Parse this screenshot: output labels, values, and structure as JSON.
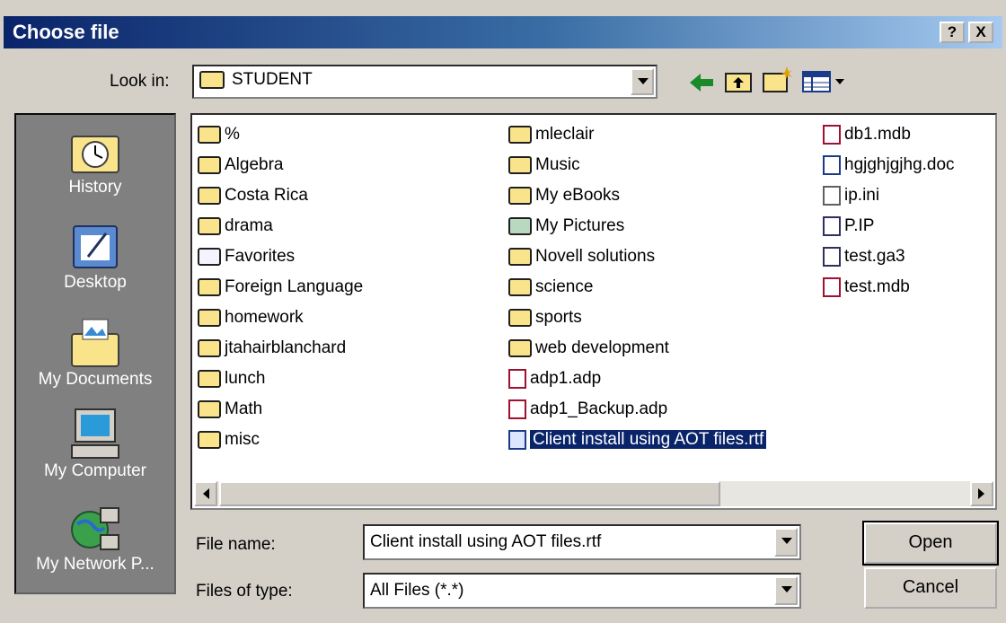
{
  "window": {
    "title": "Choose file"
  },
  "titlebar": {
    "help_label": "?",
    "close_label": "X"
  },
  "lookin": {
    "label": "Look in:",
    "value": "STUDENT"
  },
  "places": [
    {
      "label": "History",
      "icon": "history-icon"
    },
    {
      "label": "Desktop",
      "icon": "desktop-icon"
    },
    {
      "label": "My Documents",
      "icon": "my-documents-icon"
    },
    {
      "label": "My Computer",
      "icon": "my-computer-icon"
    },
    {
      "label": "My Network P...",
      "icon": "network-places-icon"
    }
  ],
  "files": {
    "col1": [
      "%",
      "Algebra",
      "Costa Rica",
      "drama",
      "Favorites",
      "Foreign Language",
      "homework",
      "jtahairblanchard",
      "lunch",
      "Math",
      "misc"
    ],
    "col2": [
      "mleclair",
      "Music",
      "My eBooks",
      "My Pictures",
      "Novell solutions",
      "science",
      "sports",
      "web development",
      "adp1.adp",
      "adp1_Backup.adp",
      "Client install using AOT files.rtf"
    ],
    "col3": [
      "db1.mdb",
      "hgjghjgjhg.doc",
      "ip.ini",
      "P.IP",
      "test.ga3",
      "test.mdb"
    ],
    "selected": "Client install using AOT files.rtf"
  },
  "filename": {
    "label": "File name:",
    "value": "Client install using AOT files.rtf"
  },
  "filetype": {
    "label": "Files of type:",
    "value": "All Files (*.*)"
  },
  "buttons": {
    "open": "Open",
    "cancel": "Cancel"
  }
}
